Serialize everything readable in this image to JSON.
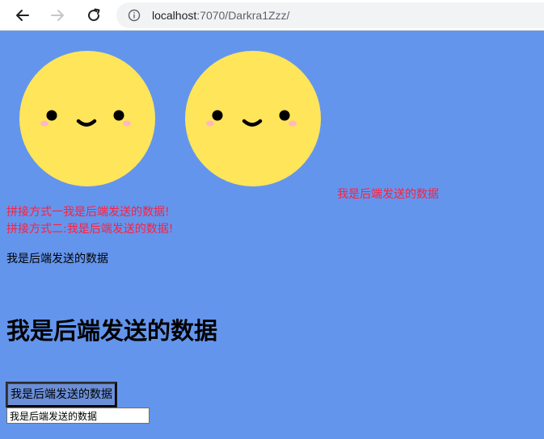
{
  "browser": {
    "url_host": "localhost",
    "url_rest": ":7070/Darkra1Zzz/",
    "icons": {
      "back": "back-arrow-icon",
      "forward": "forward-arrow-icon",
      "reload": "reload-icon",
      "info": "info-icon"
    }
  },
  "page": {
    "background_color": "#6495ed",
    "faces": [
      {
        "name": "smiley-face",
        "color": "#ffe55a"
      },
      {
        "name": "smiley-face",
        "color": "#ffe55a"
      }
    ],
    "floating_text": "我是后端发送的数据",
    "concat_method_1": "拼接方式一我是后端发送的数据!",
    "concat_method_2": "拼接方式二:我是后端发送的数据!",
    "plain_text": "我是后端发送的数据",
    "heading": "我是后端发送的数据",
    "button_label": "我是后端发送的数据",
    "input_value": "我是后端发送的数据",
    "accent_red": "#ff1f3d"
  }
}
